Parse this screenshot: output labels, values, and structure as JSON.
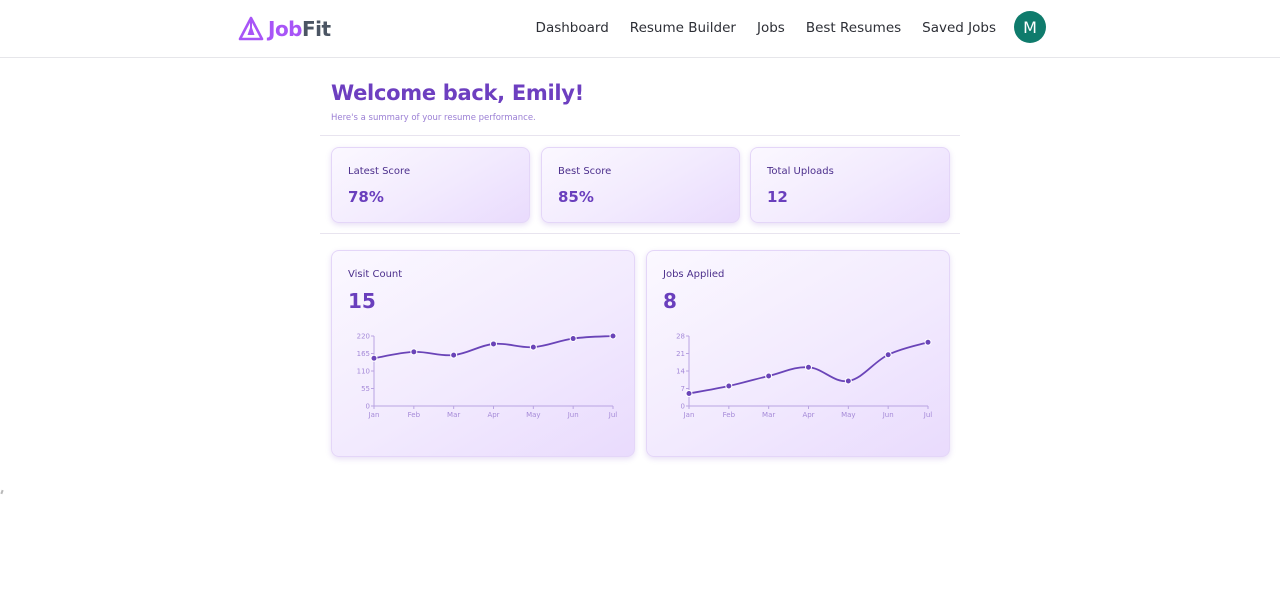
{
  "brand": {
    "part1": "Job",
    "part2": "Fit",
    "icon": "triangle-logo-icon"
  },
  "nav": {
    "links": [
      "Dashboard",
      "Resume Builder",
      "Jobs",
      "Best Resumes",
      "Saved Jobs"
    ],
    "avatar_initial": "M"
  },
  "welcome": {
    "title": "Welcome back, Emily!",
    "subtitle": "Here's a summary of your resume performance."
  },
  "stats": [
    {
      "label": "Latest Score",
      "value": "78%"
    },
    {
      "label": "Best Score",
      "value": "85%"
    },
    {
      "label": "Total Uploads",
      "value": "12"
    }
  ],
  "colors": {
    "accent": "#6a3fbd",
    "logo_purple": "#a855f7",
    "avatar_teal": "#0f7b6c",
    "line": "#6a44b8"
  },
  "chart_data": [
    {
      "type": "line",
      "title": "Visit Count",
      "headline_value": "15",
      "categories": [
        "Jan",
        "Feb",
        "Mar",
        "Apr",
        "May",
        "Jun",
        "Jul"
      ],
      "values": [
        150,
        170,
        160,
        195,
        185,
        212,
        220
      ],
      "yticks": [
        0,
        55,
        110,
        165,
        220
      ],
      "ylim": [
        0,
        220
      ],
      "grid": false
    },
    {
      "type": "line",
      "title": "Jobs Applied",
      "headline_value": "8",
      "categories": [
        "Jan",
        "Feb",
        "Mar",
        "Apr",
        "May",
        "Jun",
        "Jul"
      ],
      "values": [
        5,
        8,
        12,
        15.5,
        10,
        20.5,
        25.5
      ],
      "yticks": [
        0,
        7,
        14,
        21,
        28
      ],
      "ylim": [
        0,
        28
      ],
      "grid": false
    }
  ]
}
